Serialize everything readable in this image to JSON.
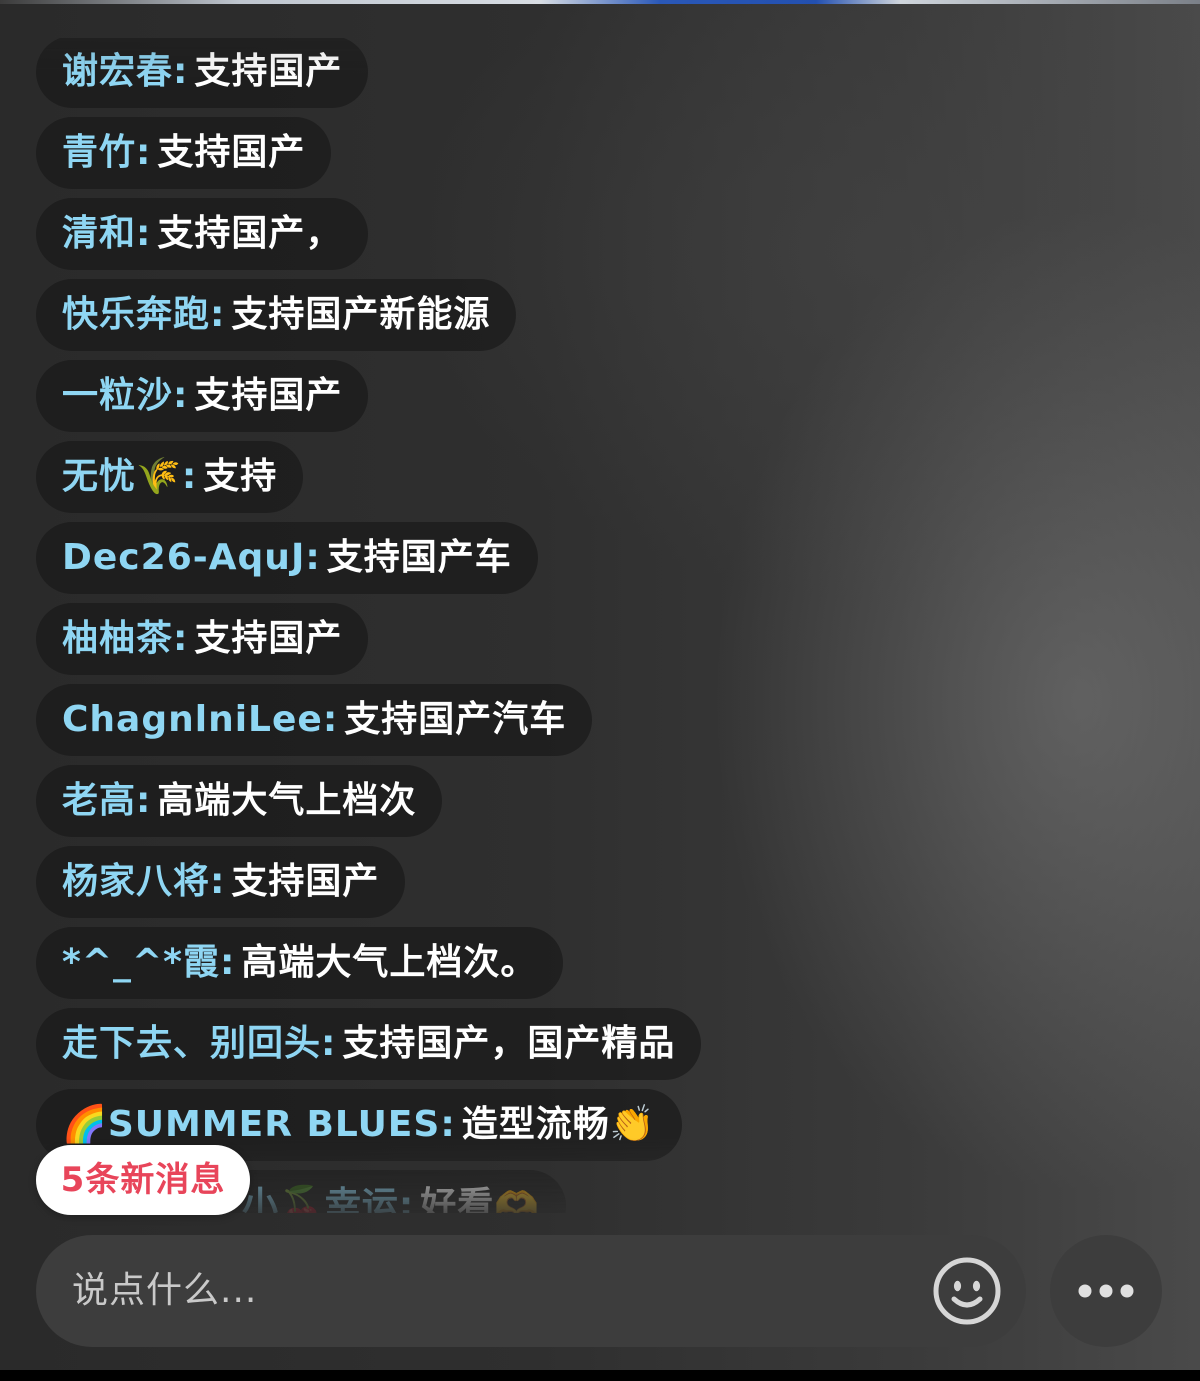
{
  "messages": [
    {
      "user": "谢宏春",
      "text": "支持国产"
    },
    {
      "user": "青竹",
      "text": "支持国产"
    },
    {
      "user": "清和",
      "text": "支持国产，"
    },
    {
      "user": "快乐奔跑",
      "text": "支持国产新能源"
    },
    {
      "user": "一粒沙",
      "text": "支持国产"
    },
    {
      "user": "无忧🌾",
      "text": "支持"
    },
    {
      "user": "Dec26-AquJ",
      "text": "支持国产车"
    },
    {
      "user": "柚柚茶",
      "text": "支持国产"
    },
    {
      "user": "ChagnlniLee",
      "text": "支持国产汽车"
    },
    {
      "user": "老高",
      "text": "高端大气上档次"
    },
    {
      "user": "杨家八将",
      "text": "支持国产"
    },
    {
      "user": "*^_^*霞",
      "text": "高端大气上档次。"
    },
    {
      "user": "走下去、别回头",
      "text": "支持国产，国产精品"
    },
    {
      "user": "🌈SUMMER BLUES",
      "text": "造型流畅👏"
    },
    {
      "user": "小🍒幸运",
      "text": "好看🫶"
    }
  ],
  "colon": ":",
  "new_messages_badge": "5条新消息",
  "input": {
    "placeholder": "说点什么..."
  },
  "icons": {
    "emoji_button": "smiley-face-icon",
    "more_button": "more-dots-icon"
  },
  "colors": {
    "username": "#8fd6f3",
    "message_text": "#ffffff",
    "badge_text": "#e8455a"
  }
}
